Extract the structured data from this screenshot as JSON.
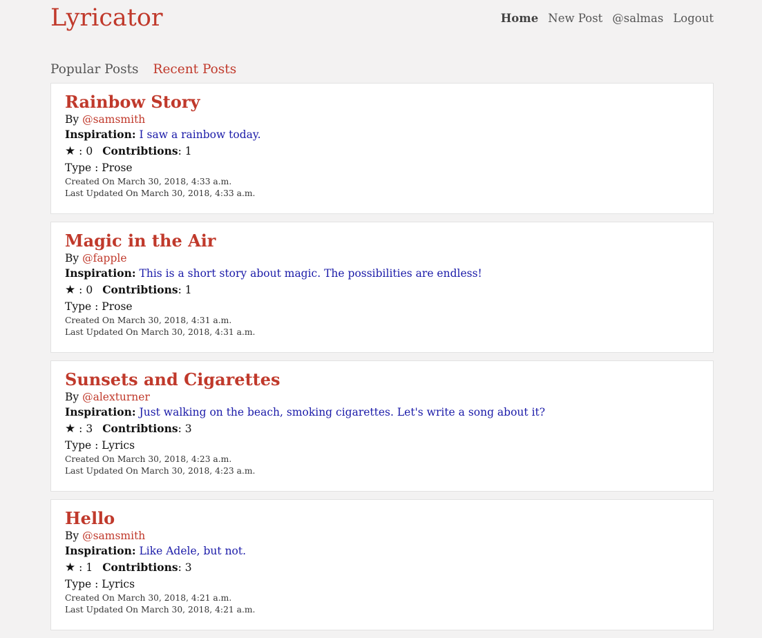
{
  "brand": "Lyricator",
  "nav": {
    "home": "Home",
    "new_post": "New Post",
    "user": "@salmas",
    "logout": "Logout"
  },
  "tabs": {
    "popular": "Popular Posts",
    "recent": "Recent Posts"
  },
  "labels": {
    "by": "By ",
    "inspiration": "Inspiration:",
    "star": "★",
    "contributions": "Contribtions",
    "type": "Type : ",
    "created": "Created On ",
    "updated": "Last Updated On "
  },
  "posts": [
    {
      "title": "Rainbow Story",
      "author": "@samsmith",
      "inspiration": "I saw a rainbow today.",
      "stars": "0",
      "contributions": "1",
      "type": "Prose",
      "created": "March 30, 2018, 4:33 a.m.",
      "updated": "March 30, 2018, 4:33 a.m."
    },
    {
      "title": "Magic in the Air",
      "author": "@fapple",
      "inspiration": "This is a short story about magic. The possibilities are endless!",
      "stars": "0",
      "contributions": "1",
      "type": "Prose",
      "created": "March 30, 2018, 4:31 a.m.",
      "updated": "March 30, 2018, 4:31 a.m."
    },
    {
      "title": "Sunsets and Cigarettes",
      "author": "@alexturner",
      "inspiration": "Just walking on the beach, smoking cigarettes. Let's write a song about it?",
      "stars": "3",
      "contributions": "3",
      "type": "Lyrics",
      "created": "March 30, 2018, 4:23 a.m.",
      "updated": "March 30, 2018, 4:23 a.m."
    },
    {
      "title": "Hello",
      "author": "@samsmith",
      "inspiration": "Like Adele, but not.",
      "stars": "1",
      "contributions": "3",
      "type": "Lyrics",
      "created": "March 30, 2018, 4:21 a.m.",
      "updated": "March 30, 2018, 4:21 a.m."
    }
  ]
}
